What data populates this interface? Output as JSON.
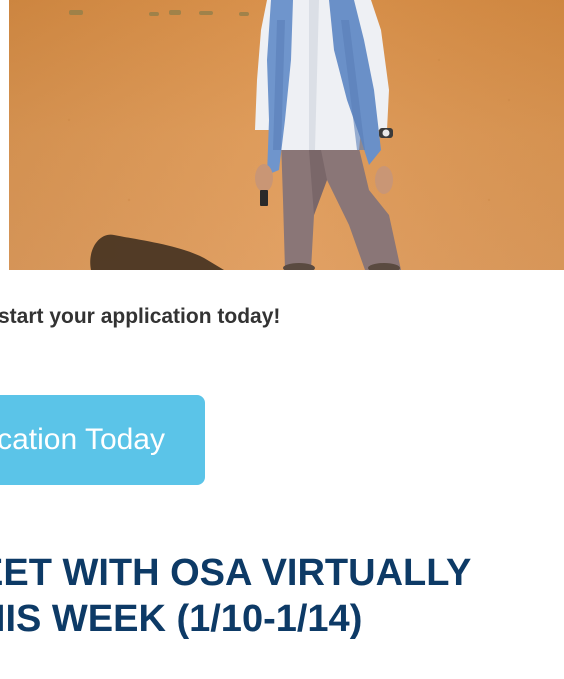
{
  "hero": {
    "image_alt": "Student in a white shirt and blue scarf standing on orange desert sand dunes"
  },
  "cta": {
    "text": "start your application today!"
  },
  "apply_button": {
    "label": "cation Today"
  },
  "section_heading": {
    "line1": "EET WITH OSA VIRTUALLY",
    "line2": "HIS WEEK (1/10-1/14)"
  },
  "colors": {
    "button": "#5bc4e8",
    "heading": "#0d3a66",
    "body_text": "#333333",
    "sand": "#dd9551"
  }
}
